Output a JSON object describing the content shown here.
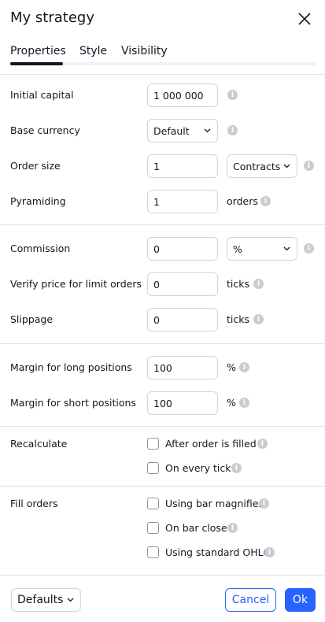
{
  "dialog": {
    "title": "My strategy",
    "close_icon": "close-icon"
  },
  "tabs": [
    {
      "label": "Properties",
      "active": true
    },
    {
      "label": "Style",
      "active": false
    },
    {
      "label": "Visibility",
      "active": false
    }
  ],
  "capital": {
    "initial_capital": {
      "label": "Initial capital",
      "value": "1 000 000"
    },
    "base_currency": {
      "label": "Base currency",
      "value": "Default"
    },
    "order_size": {
      "label": "Order size",
      "value": "1",
      "unit_value": "Contracts"
    },
    "pyramiding": {
      "label": "Pyramiding",
      "value": "1",
      "unit": "orders"
    }
  },
  "costs": {
    "commission": {
      "label": "Commission",
      "value": "0",
      "unit_value": "%"
    },
    "verify_price": {
      "label": "Verify price for limit orders",
      "value": "0",
      "unit": "ticks"
    },
    "slippage": {
      "label": "Slippage",
      "value": "0",
      "unit": "ticks"
    }
  },
  "margin": {
    "long": {
      "label": "Margin for long positions",
      "value": "100",
      "unit": "%"
    },
    "short": {
      "label": "Margin for short positions",
      "value": "100",
      "unit": "%"
    }
  },
  "recalculate": {
    "label": "Recalculate",
    "options": [
      {
        "label": "After order is filled",
        "checked": false
      },
      {
        "label": "On every tick",
        "checked": false
      }
    ]
  },
  "fill_orders": {
    "label": "Fill orders",
    "options": [
      {
        "label": "Using bar magnifier",
        "checked": false
      },
      {
        "label": "On bar close",
        "checked": false
      },
      {
        "label": "Using standard OHLC",
        "checked": false
      }
    ]
  },
  "footer": {
    "defaults_label": "Defaults",
    "cancel_label": "Cancel",
    "ok_label": "Ok"
  },
  "colors": {
    "accent": "#2962ff",
    "text": "#131722",
    "border": "#d1d4dc",
    "info_icon": "#c9ccd3"
  }
}
